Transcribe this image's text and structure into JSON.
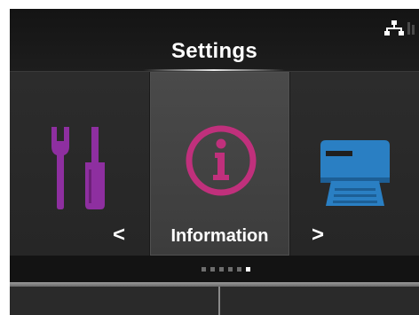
{
  "header": {
    "title": "Settings",
    "status_icons": [
      "network-icon"
    ]
  },
  "carousel": {
    "items": [
      {
        "label": "",
        "icon": "tools-icon",
        "color": "#8e2fa0"
      },
      {
        "label": "Information",
        "icon": "info-icon",
        "color": "#c0307c"
      },
      {
        "label": "",
        "icon": "printer-icon",
        "color": "#2a7fc3"
      }
    ],
    "selected_index": 1,
    "prev_glyph": "<",
    "next_glyph": ">"
  },
  "page_indicator": {
    "count": 6,
    "active": 5
  },
  "softkeys": {
    "left_label": "",
    "right_label": ""
  }
}
